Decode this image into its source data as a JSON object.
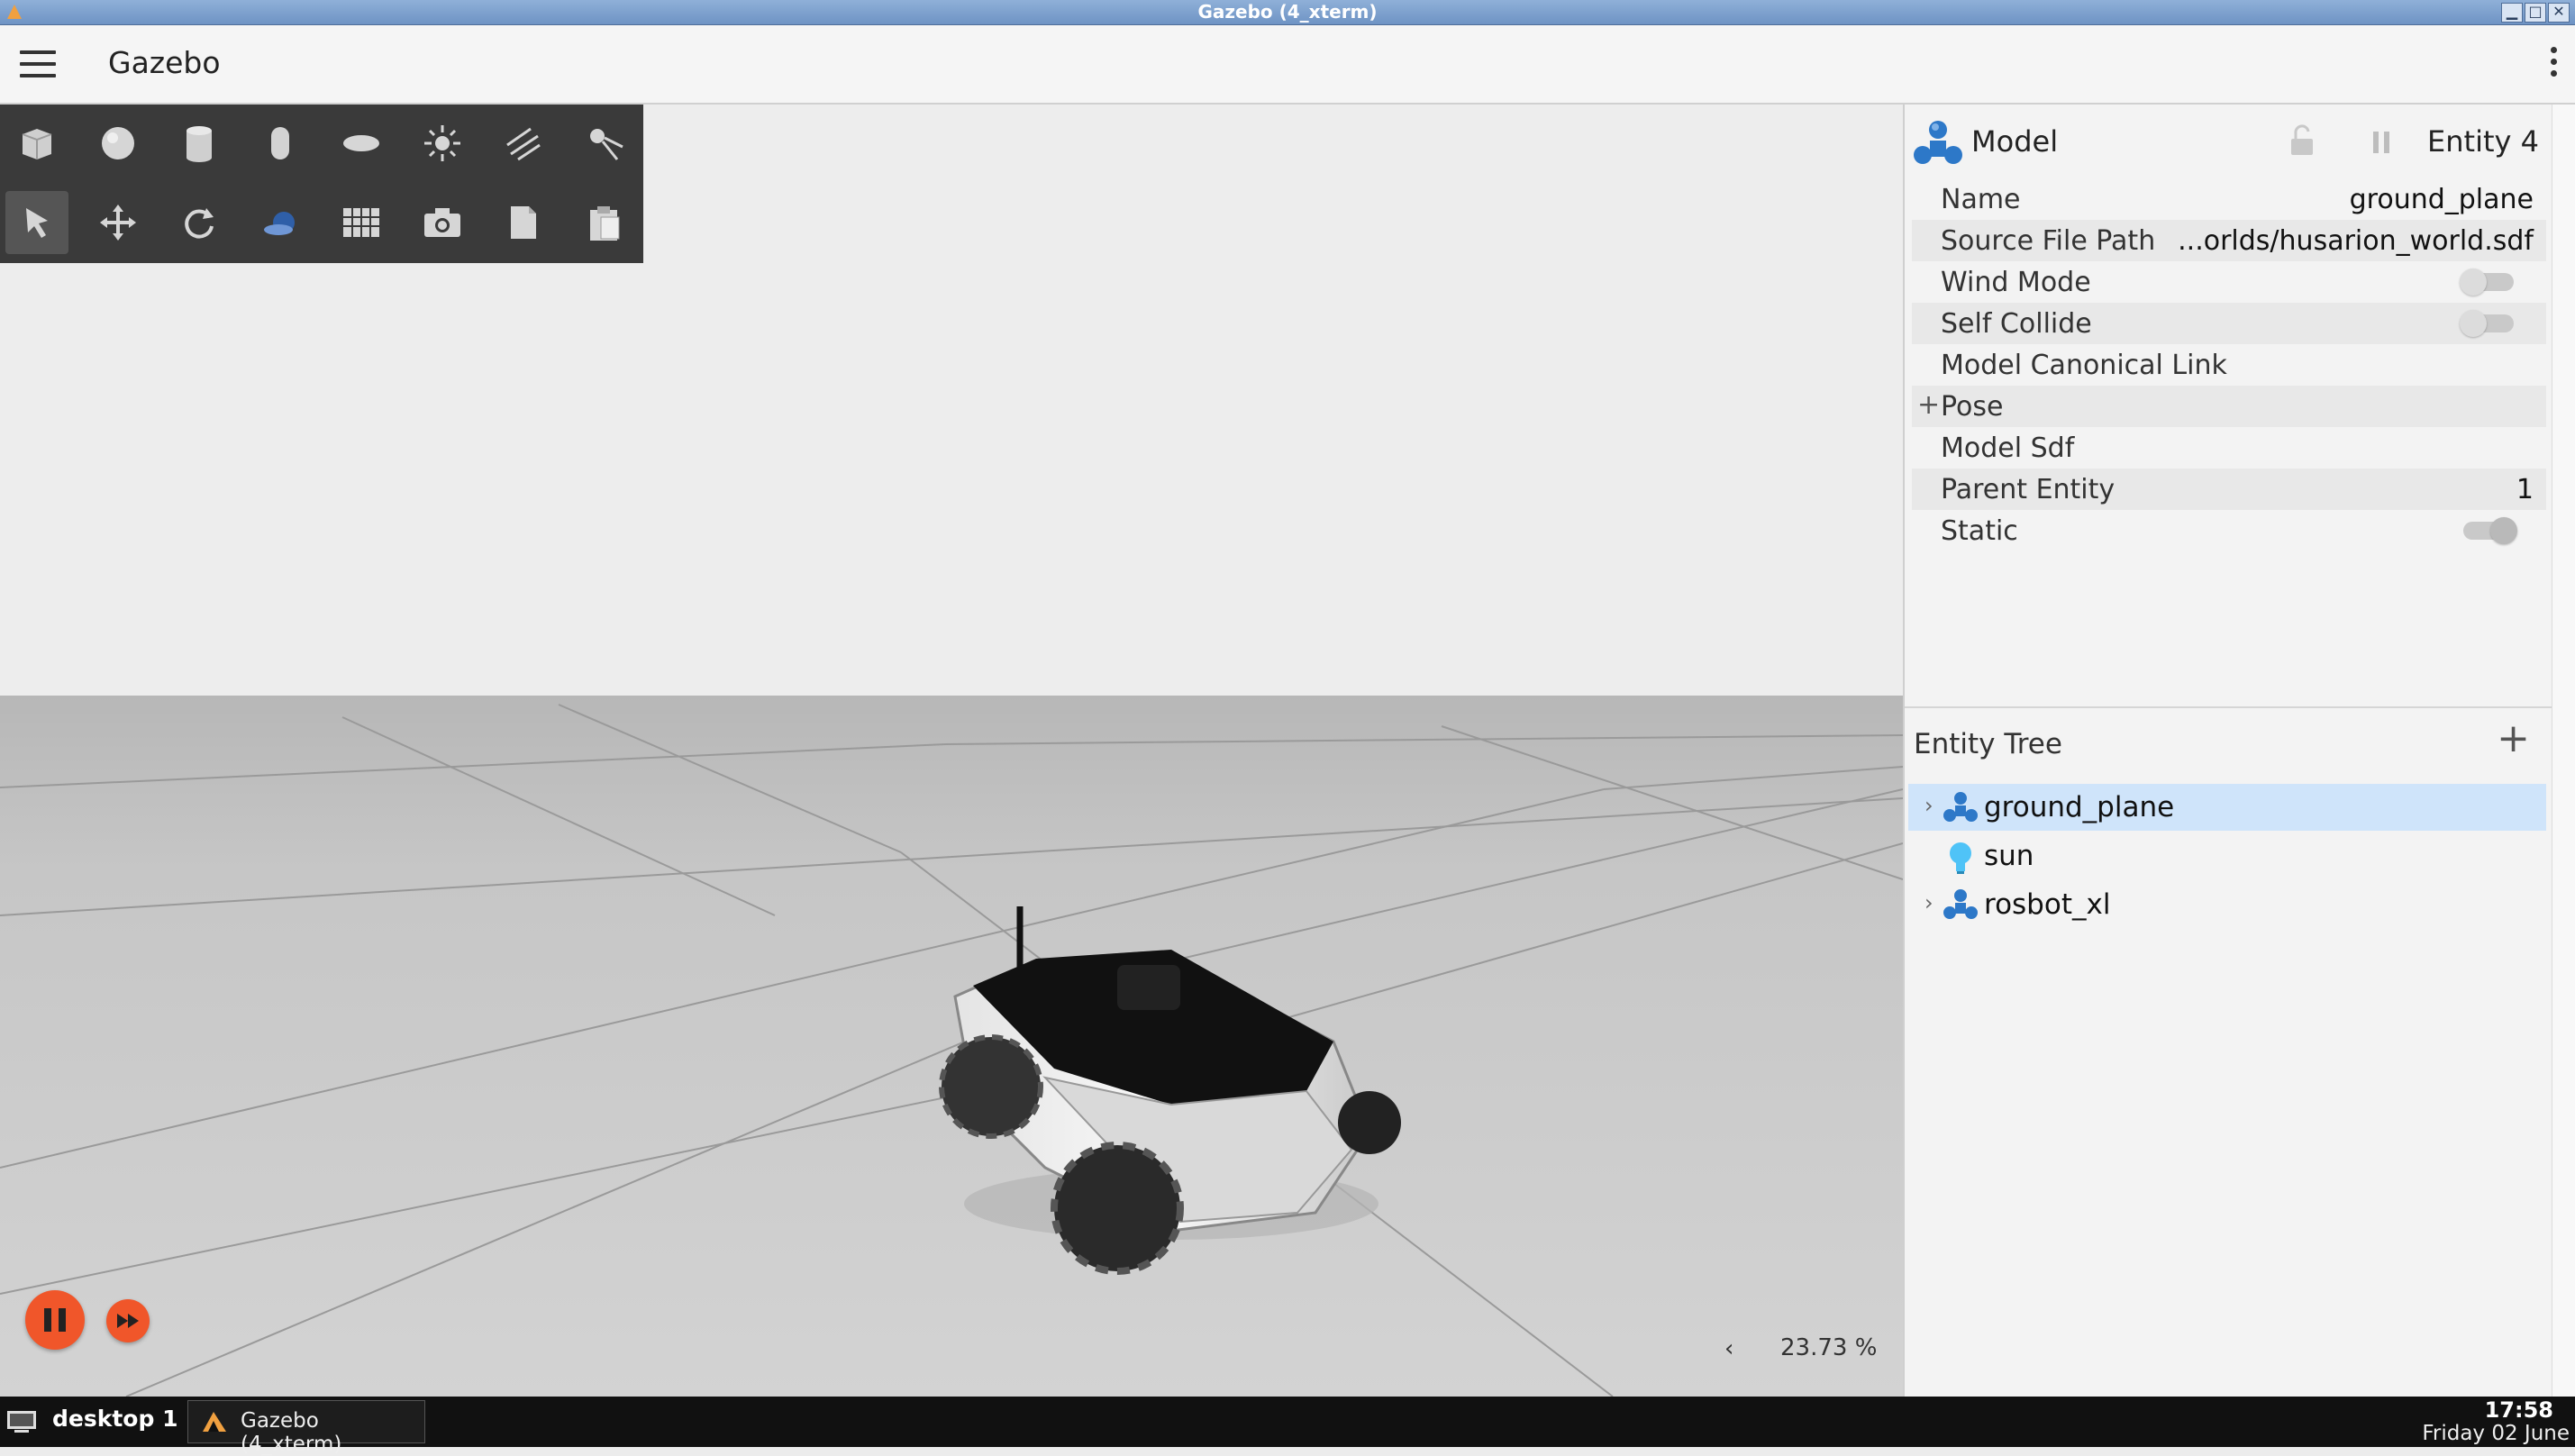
{
  "window": {
    "title": "Gazebo (4_xterm)",
    "controls": [
      "minimize",
      "maximize",
      "close"
    ]
  },
  "app": {
    "title": "Gazebo",
    "menu_icon": "hamburger-menu-icon",
    "overflow_icon": "kebab-menu-icon"
  },
  "toolbar": {
    "row1": [
      "box-shape-icon",
      "sphere-shape-icon",
      "cylinder-shape-icon",
      "capsule-shape-icon",
      "ellipsoid-shape-icon",
      "point-light-icon",
      "directional-light-icon",
      "spot-light-icon"
    ],
    "row2": [
      "select-mode-icon",
      "translate-mode-icon",
      "rotate-mode-icon",
      "view-angle-icon",
      "grid-config-icon",
      "screenshot-icon",
      "copy-icon",
      "paste-icon"
    ]
  },
  "scene": {
    "background": "#ededed",
    "ground": "#c9c9c9",
    "robot": "rosbot_xl"
  },
  "sim_controls": {
    "accent": "#f0562a",
    "play_state": "pause-icon",
    "step_icon": "fast-forward-icon",
    "real_time_factor": "23.73 %",
    "collapse_icon": "chevron-left-icon"
  },
  "component_inspector": {
    "type_label": "Model",
    "entity_label": "Entity 4",
    "properties": [
      {
        "key": "Name",
        "value": "ground_plane"
      },
      {
        "key": "Source File Path",
        "value": "...orlds/husarion_world.sdf"
      },
      {
        "key": "Wind Mode",
        "toggle": false
      },
      {
        "key": "Self Collide",
        "toggle": false
      },
      {
        "key": "Model Canonical Link",
        "value": ""
      },
      {
        "key": "Pose",
        "value": "",
        "expandable": true
      },
      {
        "key": "Model Sdf",
        "value": ""
      },
      {
        "key": "Parent Entity",
        "value": "1"
      },
      {
        "key": "Static",
        "toggle": true
      }
    ]
  },
  "entity_tree": {
    "title": "Entity Tree",
    "add_icon": "plus-icon",
    "selection_color": "#cfe4fa",
    "items": [
      {
        "label": "ground_plane",
        "icon": "model-icon",
        "expandable": true,
        "selected": true
      },
      {
        "label": "sun",
        "icon": "light-bulb-icon",
        "expandable": false,
        "selected": false
      },
      {
        "label": "rosbot_xl",
        "icon": "model-icon",
        "expandable": true,
        "selected": false
      }
    ]
  },
  "taskbar": {
    "desktop": "desktop 1",
    "task": "Gazebo (4_xterm)",
    "time": "17:58",
    "date": "Friday 02 June"
  }
}
